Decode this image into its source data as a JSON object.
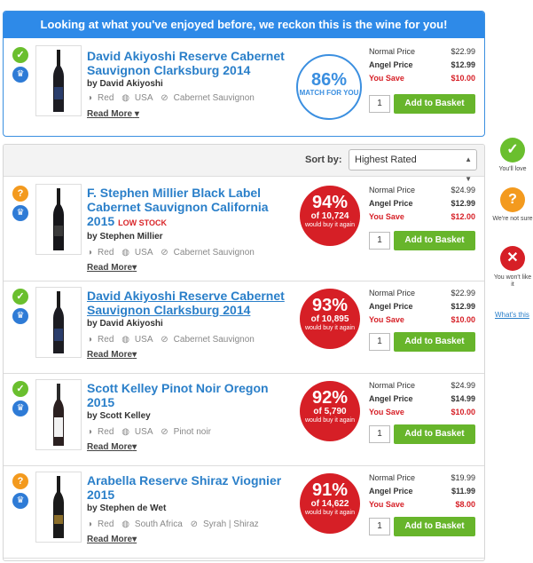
{
  "featured": {
    "heading": "Looking at what you've enjoyed before, we reckon this is the wine for you!",
    "wine": {
      "name": "David Akiyoshi Reserve Cabernet Sauvignon Clarksburg 2014",
      "maker": "by David Akiyoshi",
      "color": "Red",
      "country": "USA",
      "grape": "Cabernet Sauvignon",
      "read_more": "Read More",
      "match_pct": "86%",
      "match_label": "MATCH FOR YOU",
      "normal_label": "Normal Price",
      "normal_price": "$22.99",
      "angel_label": "Angel Price",
      "angel_price": "$12.99",
      "save_label": "You Save",
      "save_amount": "$10.00",
      "qty": "1",
      "add_label": "Add to Basket"
    }
  },
  "sort": {
    "label": "Sort by:",
    "selected": "Highest Rated"
  },
  "wines": [
    {
      "status": "?",
      "name_line1": "F. Stephen Millier Black Label",
      "name_line2": "Cabernet Sauvignon California",
      "name_line3": "2015",
      "low_stock": "LOW STOCK",
      "maker": "by Stephen Millier",
      "color": "Red",
      "country": "USA",
      "grape": "Cabernet Sauvignon",
      "read_more": "Read More",
      "pct": "94%",
      "of": "of 10,724",
      "would": "would buy it again",
      "normal_price": "$24.99",
      "angel_price": "$12.99",
      "save_amount": "$12.00",
      "qty": "1"
    },
    {
      "status": "✓",
      "name_line1": "David Akiyoshi Reserve Cabernet",
      "name_line2": "Sauvignon Clarksburg 2014",
      "maker": "by David Akiyoshi",
      "color": "Red",
      "country": "USA",
      "grape": "Cabernet Sauvignon",
      "read_more": "Read More",
      "pct": "93%",
      "of": "of 10,895",
      "would": "would buy it again",
      "normal_price": "$22.99",
      "angel_price": "$12.99",
      "save_amount": "$10.00",
      "qty": "1"
    },
    {
      "status": "✓",
      "name_line1": "Scott Kelley Pinot Noir Oregon",
      "name_line2": "2015",
      "maker": "by Scott Kelley",
      "color": "Red",
      "country": "USA",
      "grape": "Pinot noir",
      "read_more": "Read More",
      "pct": "92%",
      "of": "of 5,790",
      "would": "would buy it again",
      "normal_price": "$24.99",
      "angel_price": "$14.99",
      "save_amount": "$10.00",
      "qty": "1"
    },
    {
      "status": "?",
      "name_line1": "Arabella Reserve Shiraz Viognier",
      "name_line2": "2015",
      "maker": "by Stephen de Wet",
      "color": "Red",
      "country": "South Africa",
      "grape": "Syrah | Shiraz",
      "read_more": "Read More",
      "pct": "91%",
      "of": "of 14,622",
      "would": "would buy it again",
      "normal_price": "$19.99",
      "angel_price": "$11.99",
      "save_amount": "$8.00",
      "qty": "1"
    }
  ],
  "labels": {
    "normal": "Normal Price",
    "angel": "Angel Price",
    "save": "You Save",
    "add": "Add to Basket"
  },
  "legend": {
    "love": "You'll love",
    "unsure": "We're not sure",
    "nolike": "You won't like it",
    "whats_this": "What's this"
  },
  "colors": {
    "blue": "#2e8ae8",
    "green": "#6abf2e",
    "orange": "#f39a1e",
    "red": "#d61f26"
  }
}
